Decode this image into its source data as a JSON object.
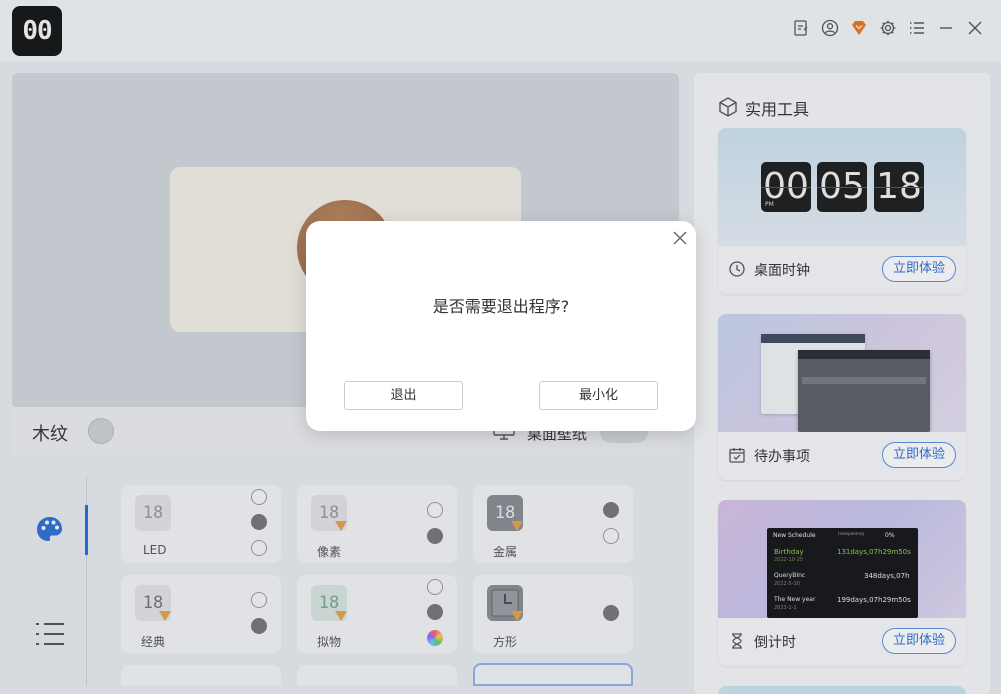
{
  "app": {
    "logo_text": "00"
  },
  "titlebar": {
    "icons": [
      "note-icon",
      "user-icon",
      "vip-gem-icon",
      "gear-icon",
      "menu-icon",
      "minimize-icon",
      "close-icon"
    ],
    "accent": "#e8761f"
  },
  "preview": {
    "style_label": "木纹",
    "wallpaper_label": "桌面壁纸",
    "wallpaper_enabled": false
  },
  "themes": {
    "sidebar": [
      "palette-icon",
      "list-icon"
    ],
    "items": [
      {
        "label": "LED",
        "thumb": "18",
        "premium": false
      },
      {
        "label": "像素",
        "thumb": "18",
        "premium": true
      },
      {
        "label": "金属",
        "thumb": "18",
        "premium": true
      },
      {
        "label": "经典",
        "thumb": "18",
        "premium": true
      },
      {
        "label": "拟物",
        "thumb": "18",
        "premium": true
      },
      {
        "label": "方形",
        "thumb": "",
        "premium": true
      }
    ]
  },
  "tools": {
    "title": "实用工具",
    "cards": [
      {
        "label": "桌面时钟",
        "button": "立即体验",
        "clock": [
          "00",
          "05",
          "18"
        ],
        "clock_suffix": "PM"
      },
      {
        "label": "待办事项",
        "button": "立即体验"
      },
      {
        "label": "倒计时",
        "button": "立即体验",
        "preview": {
          "header": "New Schedule",
          "transparency_label": "transparency",
          "transparency_value": "0%",
          "rows": [
            {
              "name": "Birthday",
              "date": "2022-10-25",
              "remain": "131days,07h29m50s"
            },
            {
              "name": "QueryBInc",
              "date": "2022-5-30",
              "remain": "348days,07h"
            },
            {
              "name": "The New year",
              "date": "2023-1-1",
              "remain": "199days,07h29m50s"
            }
          ]
        }
      }
    ]
  },
  "dialog": {
    "message": "是否需要退出程序?",
    "exit_label": "退出",
    "minimize_label": "最小化"
  },
  "colors": {
    "primary": "#2f6fd8",
    "vip": "#e8761f"
  }
}
